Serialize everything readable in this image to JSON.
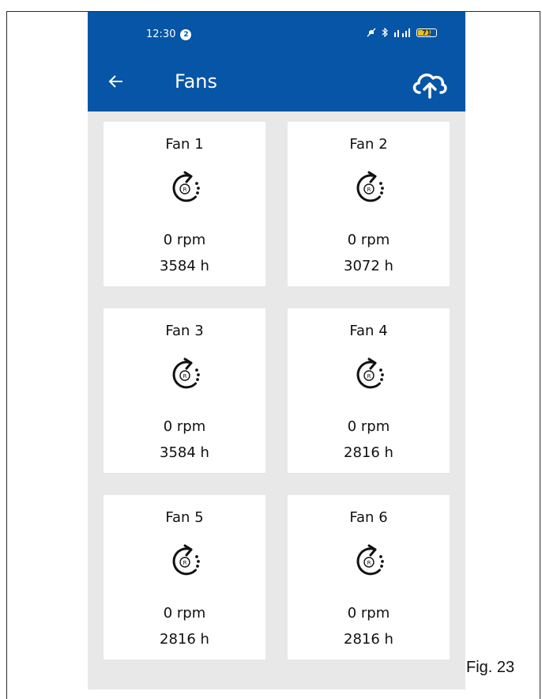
{
  "status_bar": {
    "time": "12:30",
    "notification_count": "2",
    "battery_level": "71",
    "icons": [
      "mute-icon",
      "bluetooth-icon",
      "signal-icon",
      "battery-icon"
    ]
  },
  "app_bar": {
    "title": "Fans",
    "back_icon": "arrow-left-icon",
    "action_icon": "cloud-upload-icon",
    "color": "#0655a6"
  },
  "fans": [
    {
      "name": "Fan 1",
      "rpm": "0 rpm",
      "hours": "3584 h"
    },
    {
      "name": "Fan 2",
      "rpm": "0 rpm",
      "hours": "3072 h"
    },
    {
      "name": "Fan 3",
      "rpm": "0 rpm",
      "hours": "3584 h"
    },
    {
      "name": "Fan 4",
      "rpm": "0 rpm",
      "hours": "2816 h"
    },
    {
      "name": "Fan 5",
      "rpm": "0 rpm",
      "hours": "2816 h"
    },
    {
      "name": "Fan 6",
      "rpm": "0 rpm",
      "hours": "2816 h"
    }
  ],
  "fan_icon_letter": "R",
  "figure_label": "Fig. 23"
}
